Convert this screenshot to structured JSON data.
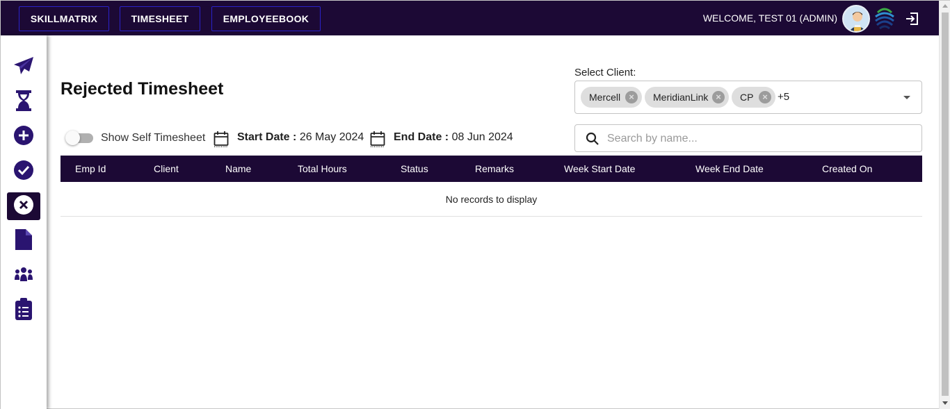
{
  "topbar": {
    "nav": [
      "SKILLMATRIX",
      "TIMESHEET",
      "EMPLOYEEBOOK"
    ],
    "welcome": "WELCOME, TEST 01 (ADMIN)",
    "icons": {
      "avatar": "user-avatar",
      "logo": "company-logo",
      "logout": "logout-icon"
    }
  },
  "sidebar": {
    "items": [
      {
        "icon": "paper-plane-icon"
      },
      {
        "icon": "hourglass-icon"
      },
      {
        "icon": "plus-circle-icon"
      },
      {
        "icon": "check-circle-icon"
      },
      {
        "icon": "x-circle-icon",
        "active": true
      },
      {
        "icon": "file-icon"
      },
      {
        "icon": "team-icon"
      },
      {
        "icon": "clipboard-list-icon"
      }
    ],
    "active_color": "#1c0935",
    "icon_color": "#2a1470"
  },
  "page": {
    "title": "Rejected Timesheet"
  },
  "client_select": {
    "label": "Select Client:",
    "chips": [
      "Mercell",
      "MeridianLink",
      "CP"
    ],
    "more": "+5"
  },
  "filters": {
    "toggle_label": "Show Self Timesheet",
    "start_label": "Start Date :",
    "start_value": "26 May 2024",
    "end_label": "End Date :",
    "end_value": "08 Jun 2024"
  },
  "search": {
    "placeholder": "Search by name..."
  },
  "table": {
    "columns": [
      "Emp Id",
      "Client",
      "Name",
      "Total Hours",
      "Status",
      "Remarks",
      "Week Start Date",
      "Week End Date",
      "Created On"
    ],
    "empty_text": "No records to display"
  },
  "colors": {
    "header_bg": "#1c0935",
    "nav_border": "#2a22c9"
  }
}
